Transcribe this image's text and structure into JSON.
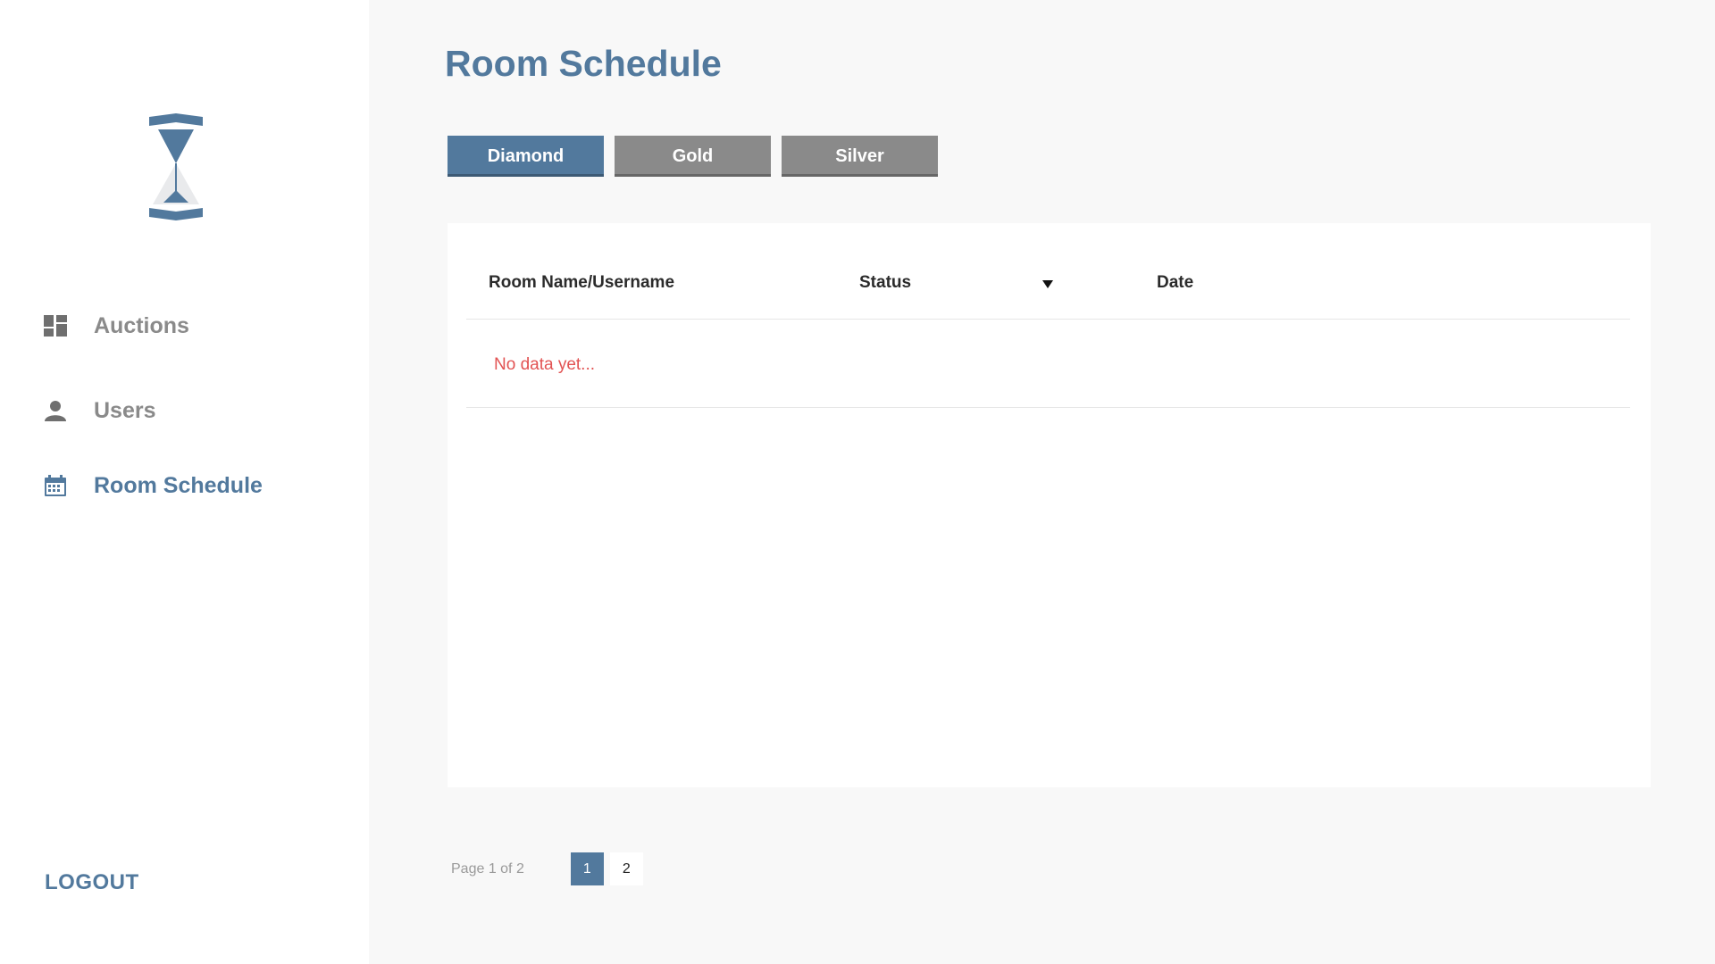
{
  "sidebar": {
    "logo_icon": "hourglass-logo",
    "items": [
      {
        "label": "Auctions",
        "icon": "dashboard-icon",
        "active": false
      },
      {
        "label": "Users",
        "icon": "user-icon",
        "active": false
      },
      {
        "label": "Room Schedule",
        "icon": "calendar-icon",
        "active": true
      }
    ],
    "logout_label": "LOGOUT"
  },
  "main": {
    "title": "Room Schedule",
    "tabs": [
      {
        "label": "Diamond",
        "active": true
      },
      {
        "label": "Gold",
        "active": false
      },
      {
        "label": "Silver",
        "active": false
      }
    ],
    "table": {
      "columns": [
        "Room Name/Username",
        "Status",
        "Date"
      ],
      "empty_message": "No data yet..."
    },
    "pagination": {
      "info": "Page 1 of 2",
      "pages": [
        "1",
        "2"
      ],
      "current": "1"
    }
  },
  "colors": {
    "accent": "#52799d",
    "inactive_tab": "#8a8a8a",
    "empty_text": "#e25353",
    "sidebar_bg": "#ffffff",
    "page_bg": "#f8f8f8"
  }
}
